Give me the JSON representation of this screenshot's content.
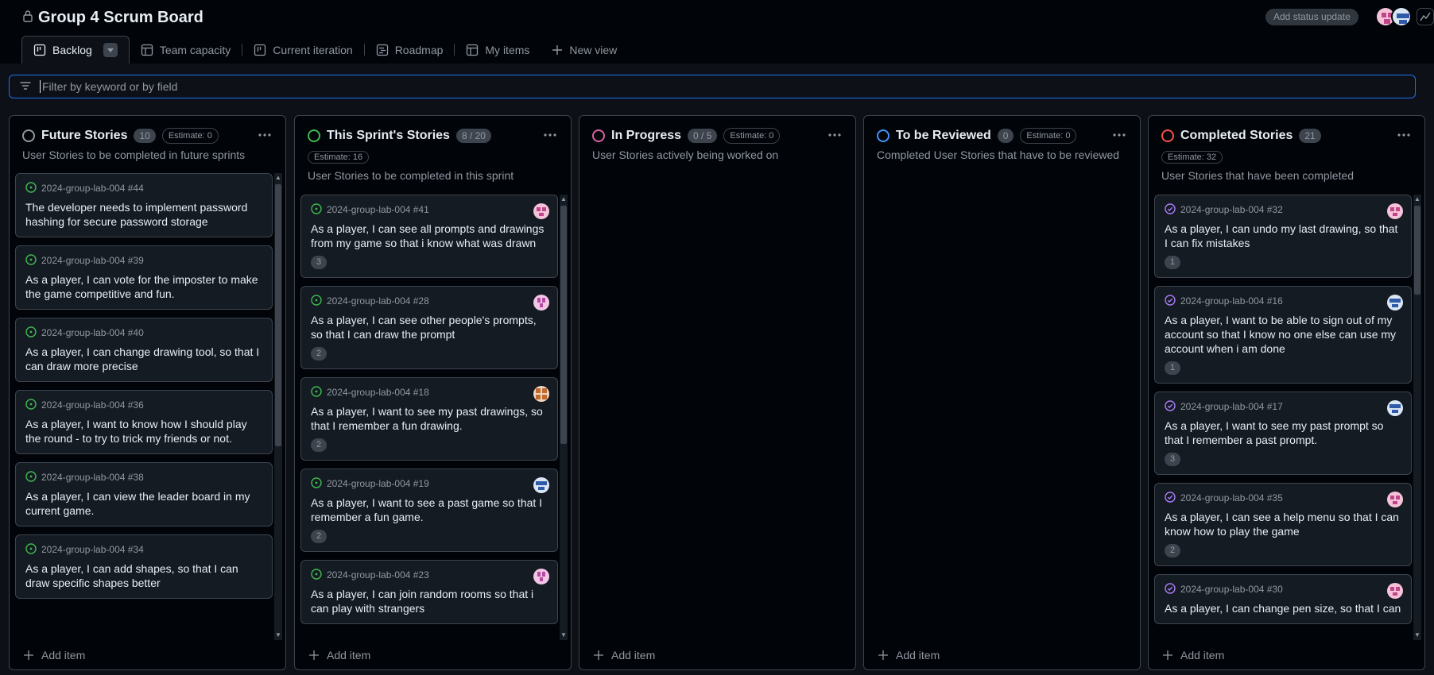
{
  "header": {
    "title": "Group 4 Scrum Board",
    "status_update_label": "Add status update"
  },
  "tabs": [
    {
      "label": "Backlog",
      "icon": "board-icon",
      "active": true
    },
    {
      "label": "Team capacity",
      "icon": "table-icon"
    },
    {
      "label": "Current iteration",
      "icon": "board-icon"
    },
    {
      "label": "Roadmap",
      "icon": "roadmap-icon"
    },
    {
      "label": "My items",
      "icon": "table-icon"
    },
    {
      "label": "New view",
      "icon": "plus-icon"
    }
  ],
  "filter": {
    "placeholder": "Filter by keyword or by field"
  },
  "add_item_label": "Add item",
  "columns": [
    {
      "name": "Future Stories",
      "count": "10",
      "estimate": "Estimate: 0",
      "description": "User Stories to be completed in future sprints",
      "color": "#9198a1",
      "cards": [
        {
          "ref": "2024-group-lab-004 #44",
          "title": "The developer needs to implement password hashing for secure password storage"
        },
        {
          "ref": "2024-group-lab-004 #39",
          "title": "As a player, I can vote for the imposter to make the game competitive and fun."
        },
        {
          "ref": "2024-group-lab-004 #40",
          "title": "As a player, I can change drawing tool, so that I can draw more precise"
        },
        {
          "ref": "2024-group-lab-004 #36",
          "title": "As a player, I want to know how I should play the round - to try to trick my friends or not."
        },
        {
          "ref": "2024-group-lab-004 #38",
          "title": "As a player, I can view the leader board in my current game."
        },
        {
          "ref": "2024-group-lab-004 #34",
          "title": "As a player, I can add shapes, so that I can draw specific shapes better"
        }
      ]
    },
    {
      "name": "This Sprint's Stories",
      "count": "8 / 20",
      "estimate": "Estimate: 16",
      "description": "User Stories to be completed in this sprint",
      "color": "#3fb950",
      "cards": [
        {
          "ref": "2024-group-lab-004 #41",
          "title": "As a player, I can see all prompts and drawings from my game so that i know what was drawn",
          "points": "3"
        },
        {
          "ref": "2024-group-lab-004 #28",
          "title": "As a player, I can see other people's prompts, so that I can draw the prompt",
          "points": "2"
        },
        {
          "ref": "2024-group-lab-004 #18",
          "title": "As a player, I want to see my past drawings, so that I remember a fun drawing.",
          "points": "2"
        },
        {
          "ref": "2024-group-lab-004 #19",
          "title": "As a player, I want to see a past game so that I remember a fun game.",
          "points": "2"
        },
        {
          "ref": "2024-group-lab-004 #23",
          "title": "As a player, I can join random rooms so that i can play with strangers"
        }
      ]
    },
    {
      "name": "In Progress",
      "count": "0 / 5",
      "estimate": "Estimate: 0",
      "description": "User Stories actively being worked on",
      "color": "#db61a2",
      "cards": []
    },
    {
      "name": "To be Reviewed",
      "count": "0",
      "estimate": "Estimate: 0",
      "description": "Completed User Stories that have to be reviewed",
      "color": "#4493f8",
      "cards": []
    },
    {
      "name": "Completed Stories",
      "count": "21",
      "estimate": "Estimate: 32",
      "description": "User Stories that have been completed",
      "color": "#f85149",
      "cards": [
        {
          "ref": "2024-group-lab-004 #32",
          "title": "As a player, I can undo my last drawing, so that I can fix mistakes",
          "points": "1"
        },
        {
          "ref": "2024-group-lab-004 #16",
          "title": "As a player, I want to be able to sign out of my account so that I know no one else can use my account when i am done",
          "points": "1"
        },
        {
          "ref": "2024-group-lab-004 #17",
          "title": "As a player, I want to see my past prompt so that I remember a past prompt.",
          "points": "3"
        },
        {
          "ref": "2024-group-lab-004 #35",
          "title": "As a player, I can see a help menu so that I can know how to play the game",
          "points": "2"
        },
        {
          "ref": "2024-group-lab-004 #30",
          "title": "As a player, I can change pen size, so that I can"
        }
      ]
    }
  ]
}
